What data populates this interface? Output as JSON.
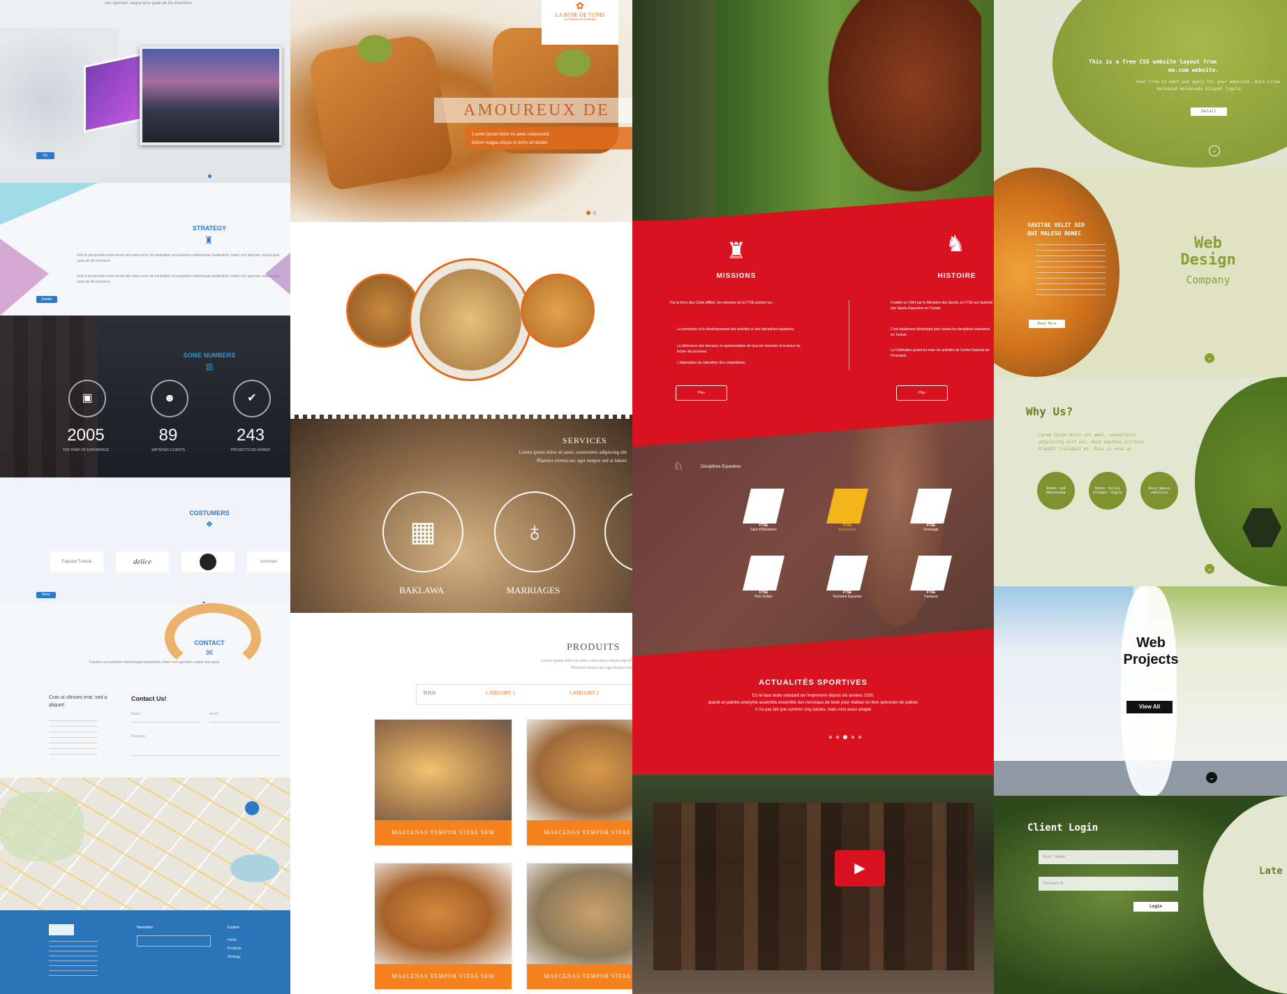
{
  "col1": {
    "hero_tagline": "nec aperiam, eaque ipsa quae ab illo inventore",
    "hero_button": "Go",
    "strategy_title": "STRATEGY",
    "strategy_text1": "Sed ut perspiciatis unde omnis iste natus error sit voluptatem accusantium doloremque laudantium, totam rem aperiam, eaque ipsa quae ab illo inventore",
    "strategy_text2": "Sed ut perspiciatis unde omnis iste natus error sit voluptatem accusantium doloremque laudantium, totam rem aperiam, eaque ipsa quae ab illo inventore",
    "strategy_button": "Details",
    "numbers_title": "SOME NUMBERS",
    "stats": [
      {
        "value": "2005",
        "label": "TEN YEAR OF EXPERIENCE"
      },
      {
        "value": "89",
        "label": "SATISFIED CLIENTS"
      },
      {
        "value": "243",
        "label": "PROJECTS DELIVERED"
      }
    ],
    "clients_title": "COSTUMERS",
    "clients": [
      "Fayrouz Tunisie",
      "delice",
      "",
      "unknown"
    ],
    "clients_button": "More",
    "contact_title": "CONTACT",
    "contact_text": "Pandora accusantium doloremque laudantium, totam rem aperiam, eaque ipsa quae",
    "contact_left": "Cras ut ultricies erat, sed a aliquet!",
    "contact_heading": "Contact Us!",
    "name_placeholder": "Name",
    "email_placeholder": "Email",
    "message_placeholder": "Message",
    "newsletter": "Newsletter",
    "explore": "Explore",
    "footer_links": [
      "Home",
      "Products",
      "Strategy"
    ]
  },
  "col2": {
    "logo_line1": "LA ROSE DE TUNIS",
    "logo_line2": "Le Patisserie Orientale",
    "banner_title": "AMOUREUX DE",
    "banner_sub1": "Lorem ipsum dolor sit amet consectetur",
    "banner_sub2": "dolore magna aliqua ut enim ad minim",
    "services_title": "SERVICES",
    "services_text1": "Lorem ipsum dolor sit amet, consectetur adipiscing elit",
    "services_text2": "Pharetra viverra nec eget tempor sed ut labore",
    "service1": "BAKLAWA",
    "service2": "MARRIAGES",
    "products_title": "PRODUITS",
    "products_text1": "Lorem ipsum dolor sit amet consectetur adipiscing elit",
    "products_text2": "Pharetra viverra nec eget tempor sed",
    "filter_all": "TOUS",
    "filter_cat1": "CATEGORY 1",
    "filter_cat2": "CATEGORY 2",
    "product_caption": "MAECENAS TEMPOR VITAE SEM"
  },
  "col3": {
    "missions_title": "MISSIONS",
    "histoire_title": "HISTOIRE",
    "missions_intro": "Par la force des Clubs affiliés, les missions de la FTSE portent sur :",
    "missions_items": [
      "La promotion et le développement des activités et des disciplines équestres.",
      "La délivrance des licences, la représentation de tous les licenciés et la tenue du fichier des licences.",
      "L'élaboration du calendrier des compétitions."
    ],
    "histoire_intro": "Fondée en 1964 par le Ministère des Sports, la FTSE est l'autorité des Sports Équestres en Tunisie",
    "histoire_items": [
      "C'est également développé pour toutes les disciplines équestres en Tunisie",
      "La Fédération prend en main les activités du Centre National de Promotion"
    ],
    "plus_button": "Plus",
    "disciplines_title": "Disciplines Équestres",
    "disciplines": [
      "Saut d'Obstacles",
      "Endurance",
      "Dressage",
      "Polo Sultan",
      "Tourisme Équestre",
      "Fantasia"
    ],
    "disc_tag": "FTSE",
    "news_title": "ACTUALITÉS SPORTIVES",
    "news_text1": "Est le faux texte standard de l'imprimerie depuis les années 1500,",
    "news_text2": "quand un peintre anonyme assembla ensemble des morceaux de texte pour réaliser un livre spécimen de polices",
    "news_text3": "Il n'a pas fait que survivre cinq siècles, mais s'est aussi adapté"
  },
  "col4": {
    "top_title": "This is a free CSS website layout from",
    "top_title2": "me.com website.",
    "top_text1": "Feel free to edit and apply for your websites. Duis vitae",
    "top_text2": "malesuad malesuada aliquet ligula.",
    "top_button": "Detail",
    "savitae1": "SAVITAE VELIT SED",
    "savitae2": "QUI MALESU DONEC",
    "savitae_button": "Read More",
    "web_design": "Web",
    "web_design2": "Design",
    "company": "Company",
    "why_title": "Why Us?",
    "why_text1": "Lorem ipsum dolor sit amet, consectetur",
    "why_text2": "adipiscing elit vel, Duis dapibus ultrices",
    "why_text3": "blandit tincidunt mi. Duis in eros ac",
    "why_circles": [
      "Donec sed malesuada",
      "Donec tellus aliquet ligula",
      "Duis massa vehicula"
    ],
    "web_projects1": "Web",
    "web_projects2": "Projects",
    "view_all": "View All",
    "client_login": "Client Login",
    "user_placeholder": "User Name",
    "pass_placeholder": "Password",
    "login_button": "Login",
    "latest": "Late"
  }
}
